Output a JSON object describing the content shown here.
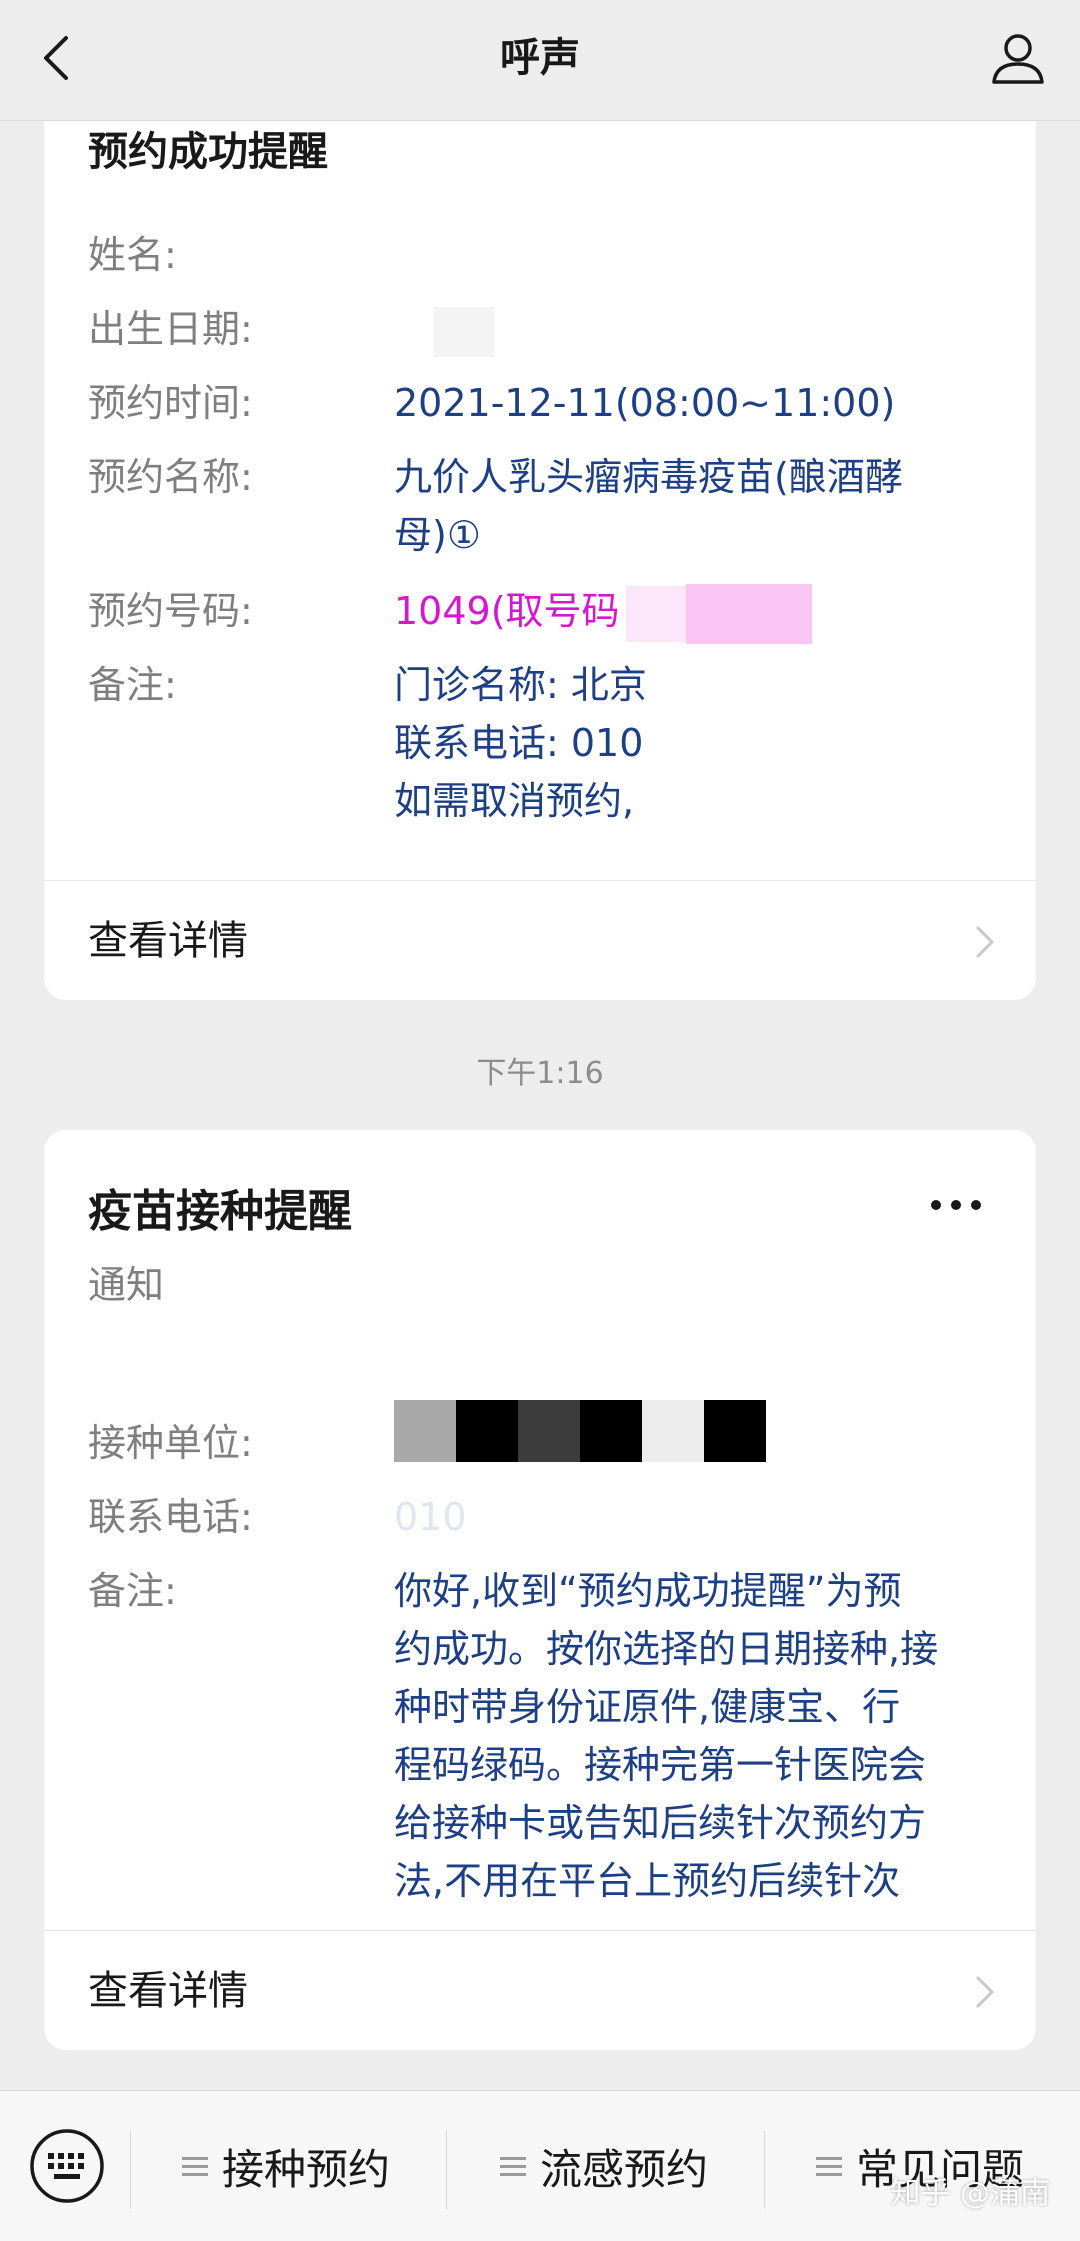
{
  "header": {
    "title": "呼声",
    "back_icon": "chevron-left-icon",
    "profile_icon": "person-icon"
  },
  "card1": {
    "partial_title": "预约成功提醒",
    "fields": [
      {
        "label": "姓名:",
        "value": ""
      },
      {
        "label": "出生日期:",
        "value": ""
      },
      {
        "label": "预约时间:",
        "value": "2021-12-11(08:00~11:00)"
      },
      {
        "label": "预约名称:",
        "value_line1": "九价人乳头瘤病毒疫苗(酿酒酵",
        "value_line2": "母)①"
      },
      {
        "label": "预约号码:",
        "value": "1049(取号码"
      },
      {
        "label": "备注:",
        "value_line1": "门诊名称: 北京",
        "value_line2": "联系电话: 010",
        "value_line3": "如需取消预约,"
      }
    ],
    "detail_label": "查看详情"
  },
  "timestamp": "下午1:16",
  "card2": {
    "title": "疫苗接种提醒",
    "subtitle": "通知",
    "fields": [
      {
        "label": "接种单位:",
        "value": ""
      },
      {
        "label": "联系电话:",
        "value": "010"
      },
      {
        "label": "备注:",
        "lines": [
          "你好,收到“预约成功提醒”为预",
          "约成功。按你选择的日期接种,接",
          "种时带身份证原件,健康宝、行",
          "程码绿码。接种完第一针医院会",
          "给接种卡或告知后续针次预约方",
          "法,不用在平台上预约后续针次"
        ]
      }
    ],
    "detail_label": "查看详情",
    "more_icon": "more-dots-icon"
  },
  "bottom_menu": {
    "keyboard_icon": "keyboard-icon",
    "items": [
      {
        "label": "接种预约"
      },
      {
        "label": "流感预约"
      },
      {
        "label": "常见问题"
      }
    ]
  },
  "watermark": "知乎 @蒲南",
  "colors": {
    "background": "#ededed",
    "value_blue": "#1d3f86",
    "highlight_pink": "#d816d0",
    "label_gray": "#7f7f7f"
  }
}
